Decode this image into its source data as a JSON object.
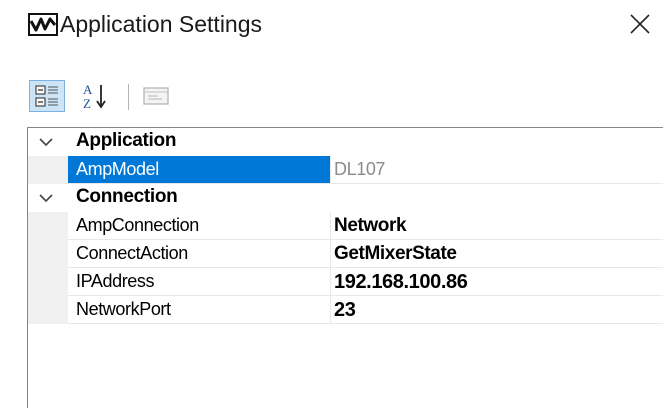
{
  "window": {
    "title": "Application Settings",
    "close_symbol": "✕"
  },
  "icons": {
    "app": "waveform-logo-icon",
    "close": "close-icon",
    "categorized": "categorized-view-icon",
    "alphabetical": "sort-alphabetical-icon",
    "property_pages": "property-pages-icon",
    "expand": "chevron-down-icon"
  },
  "colors": {
    "selection": "#0078d7",
    "toolbar_active": "#cce4f7",
    "readonly_text": "#8c8c8c"
  },
  "property_grid": {
    "categories": [
      {
        "name": "Application",
        "expanded": true,
        "properties": [
          {
            "name": "AmpModel",
            "value": "DL107",
            "readonly": true,
            "selected": true
          }
        ]
      },
      {
        "name": "Connection",
        "expanded": true,
        "properties": [
          {
            "name": "AmpConnection",
            "value": "Network",
            "readonly": false,
            "selected": false
          },
          {
            "name": "ConnectAction",
            "value": "GetMixerState",
            "readonly": false,
            "selected": false
          },
          {
            "name": "IPAddress",
            "value": "192.168.100.86",
            "readonly": false,
            "selected": false
          },
          {
            "name": "NetworkPort",
            "value": "23",
            "readonly": false,
            "selected": false
          }
        ]
      }
    ]
  }
}
